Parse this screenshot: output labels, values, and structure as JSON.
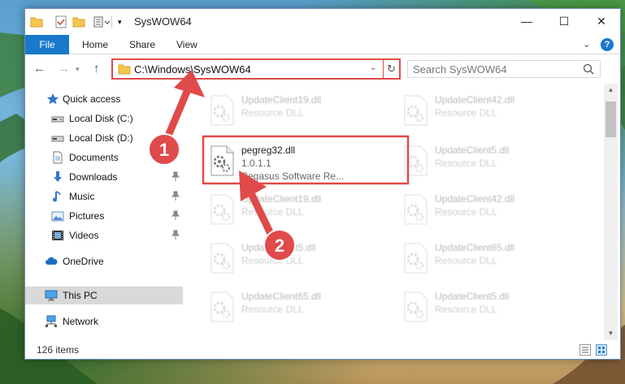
{
  "window": {
    "title": "SysWOW64",
    "controls": {
      "minimize": "—",
      "maximize": "☐",
      "close": "✕"
    }
  },
  "ribbon": {
    "tabs": [
      {
        "label": "File"
      },
      {
        "label": "Home"
      },
      {
        "label": "Share"
      },
      {
        "label": "View"
      }
    ],
    "help": "?"
  },
  "address": {
    "path": "C:\\Windows\\SysWOW64",
    "refresh": "↻"
  },
  "search": {
    "placeholder": "Search SysWOW64"
  },
  "sidebar": {
    "items": [
      {
        "label": "Quick access",
        "icon": "star-icon",
        "pinned": false
      },
      {
        "label": "Local Disk (C:)",
        "icon": "drive-icon",
        "pinned": false
      },
      {
        "label": "Local Disk (D:)",
        "icon": "drive-icon",
        "pinned": false
      },
      {
        "label": "Documents",
        "icon": "documents-icon",
        "pinned": false
      },
      {
        "label": "Downloads",
        "icon": "download-icon",
        "pinned": true
      },
      {
        "label": "Music",
        "icon": "music-icon",
        "pinned": true
      },
      {
        "label": "Pictures",
        "icon": "pictures-icon",
        "pinned": true
      },
      {
        "label": "Videos",
        "icon": "videos-icon",
        "pinned": true
      },
      {
        "label": "OneDrive",
        "icon": "cloud-icon",
        "pinned": false
      },
      {
        "label": "This PC",
        "icon": "computer-icon",
        "pinned": false,
        "selected": true
      },
      {
        "label": "Network",
        "icon": "network-icon",
        "pinned": false
      }
    ]
  },
  "files": {
    "left": [
      {
        "name": "UpdateClient19.dll",
        "type": "Resource DLL"
      },
      {
        "name": "pegreg32.dll",
        "version": "1.0.1.1",
        "company": "Pegasus Software Re..."
      },
      {
        "name": "UpdateClient19.dll",
        "type": "Resource DLL"
      },
      {
        "name": "UpdateClient5.dll",
        "type": "Resource DLL"
      },
      {
        "name": "UpdateClient65.dll",
        "type": "Resource DLL"
      }
    ],
    "right": [
      {
        "name": "UpdateClient42.dll",
        "type": "Resource DLL"
      },
      {
        "name": "UpdateClient5.dll",
        "type": "Resource DLL"
      },
      {
        "name": "UpdateClient42.dll",
        "type": "Resource DLL"
      },
      {
        "name": "UpdateClient65.dll",
        "type": "Resource DLL"
      },
      {
        "name": "UpdateClient5.dll",
        "type": "Resource DLL"
      }
    ]
  },
  "status": {
    "count": "126 items"
  },
  "annotations": {
    "step1": "1",
    "step2": "2",
    "color": "#e04a4a"
  }
}
